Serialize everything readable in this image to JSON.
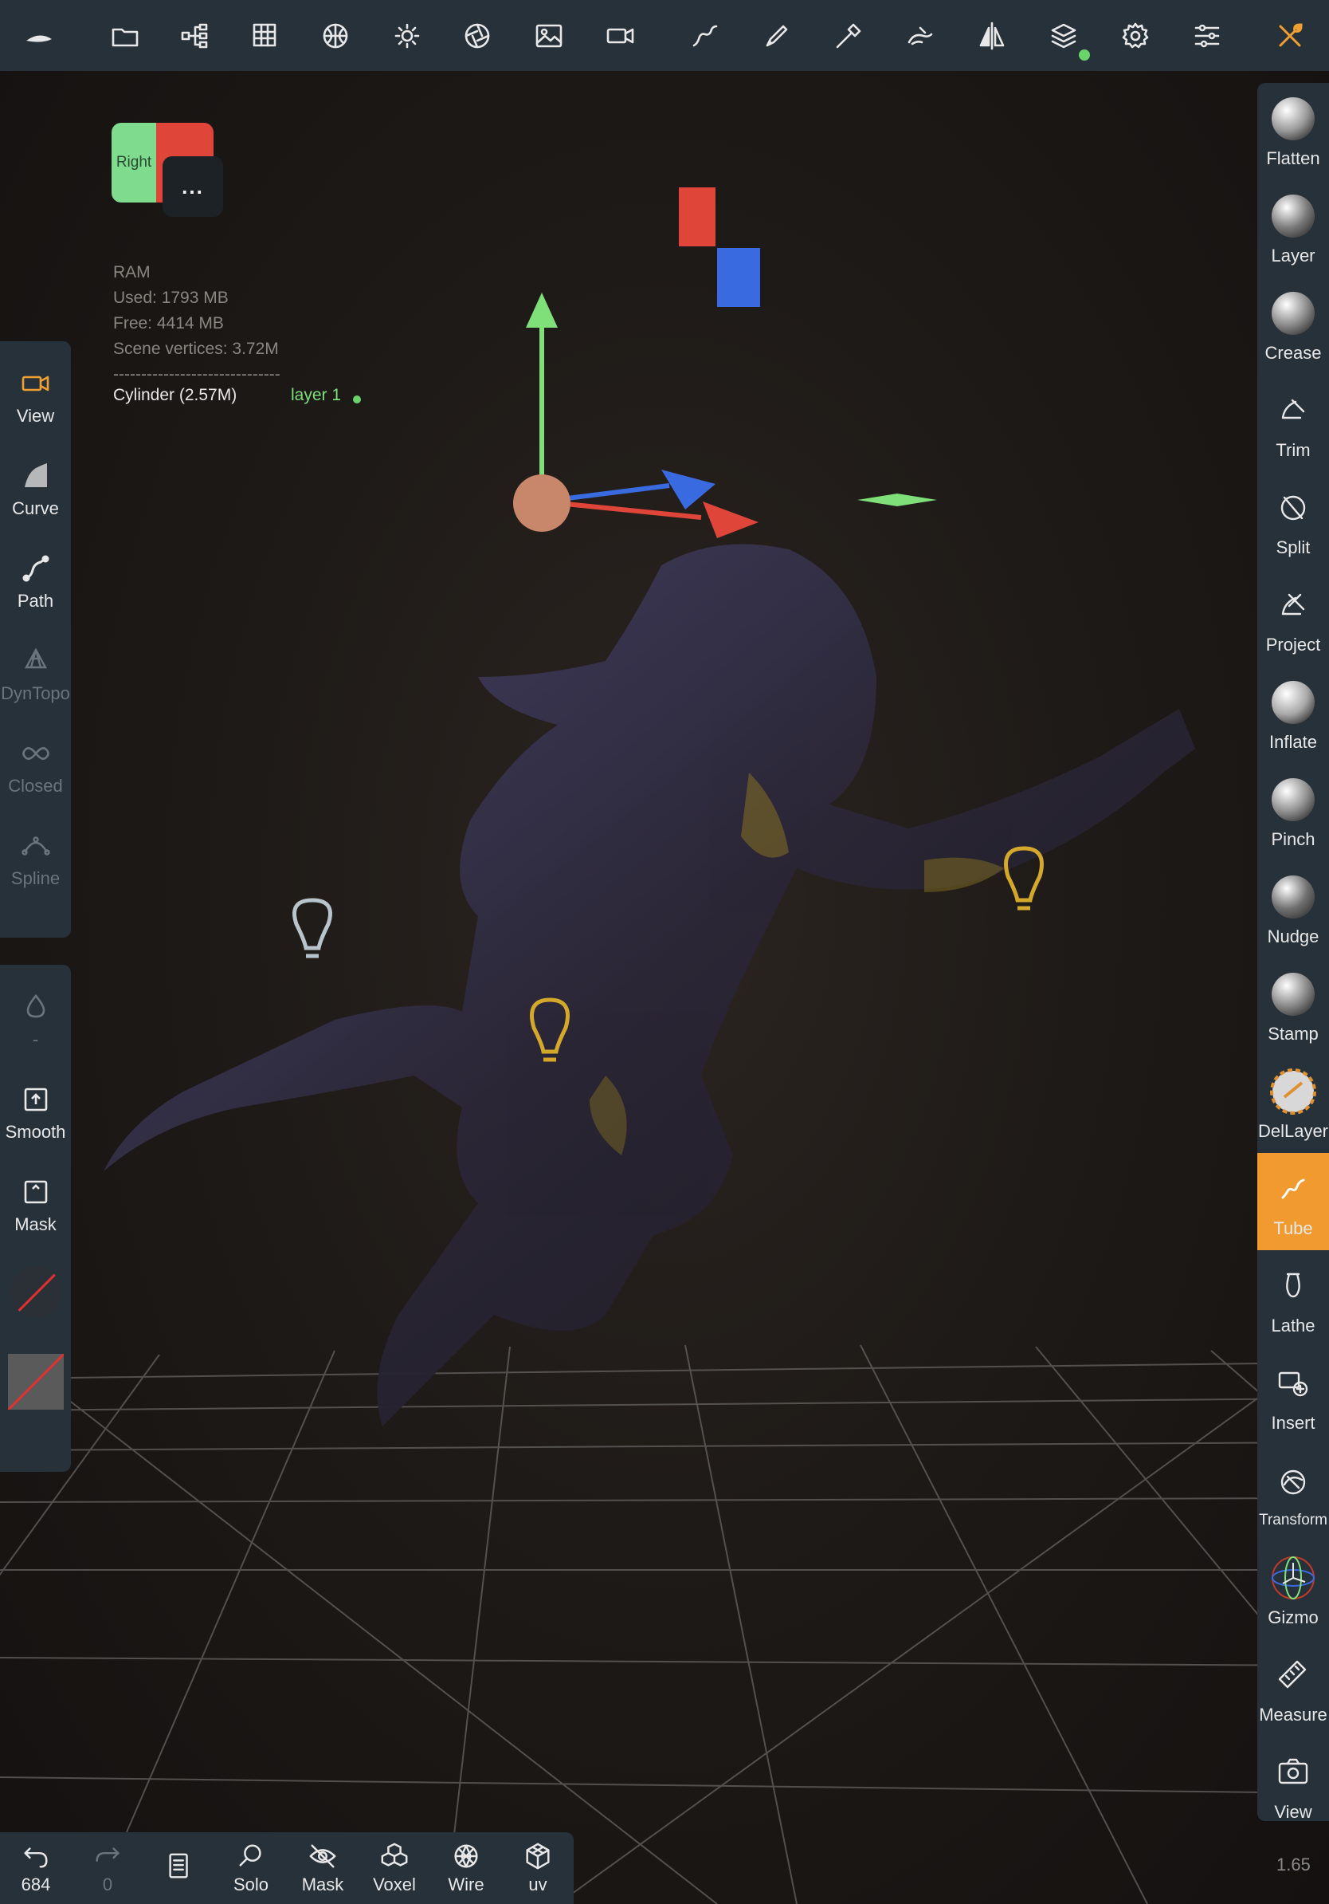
{
  "toolbar": {
    "icons": [
      "logo-icon",
      "folder-icon",
      "scene-tree-icon",
      "grid-menu-icon",
      "topology-icon",
      "light-icon",
      "shading-icon",
      "image-icon",
      "camera-icon",
      "curve-stroke-icon",
      "brush-icon",
      "paint-icon",
      "sculpt-icon",
      "symmetry-icon",
      "layers-icon",
      "settings-icon",
      "sliders-icon",
      "tools-icon"
    ]
  },
  "view_cube": {
    "face_label": "Right",
    "more_label": "..."
  },
  "info": {
    "ram_label": "RAM",
    "used": "Used: 1793 MB",
    "free": "Free: 4414 MB",
    "vertices": "Scene vertices: 3.72M",
    "separator": "------------------------------",
    "object": "Cylinder (2.57M)",
    "layer": "layer 1"
  },
  "left_top": [
    {
      "label": "View",
      "icon": "camera-icon",
      "active": true
    },
    {
      "label": "Curve",
      "icon": "curve-icon"
    },
    {
      "label": "Path",
      "icon": "path-icon"
    },
    {
      "label": "DynTopo",
      "icon": "dyntopo-icon",
      "disabled": true
    },
    {
      "label": "Closed",
      "icon": "infinity-icon",
      "disabled": true
    },
    {
      "label": "Spline",
      "icon": "spline-icon",
      "disabled": true
    }
  ],
  "left_bottom": [
    {
      "label": "-",
      "icon": "drop-icon",
      "disabled": true
    },
    {
      "label": "Smooth",
      "icon": "smooth-icon"
    },
    {
      "label": "Mask",
      "icon": "mask-icon"
    }
  ],
  "right_tools": [
    {
      "label": "Flatten",
      "icon": "flatten-icon"
    },
    {
      "label": "Layer",
      "icon": "layer-icon"
    },
    {
      "label": "Crease",
      "icon": "crease-icon"
    },
    {
      "label": "Trim",
      "icon": "trim-icon"
    },
    {
      "label": "Split",
      "icon": "split-icon"
    },
    {
      "label": "Project",
      "icon": "project-icon"
    },
    {
      "label": "Inflate",
      "icon": "inflate-icon"
    },
    {
      "label": "Pinch",
      "icon": "pinch-icon"
    },
    {
      "label": "Nudge",
      "icon": "nudge-icon"
    },
    {
      "label": "Stamp",
      "icon": "stamp-icon"
    },
    {
      "label": "DelLayer",
      "icon": "dellayer-icon"
    },
    {
      "label": "Tube",
      "icon": "tube-icon",
      "active": true
    },
    {
      "label": "Lathe",
      "icon": "lathe-icon"
    },
    {
      "label": "Insert",
      "icon": "insert-icon"
    },
    {
      "label": "Transform",
      "icon": "transform-icon"
    },
    {
      "label": "Gizmo",
      "icon": "gizmo-icon"
    },
    {
      "label": "Measure",
      "icon": "ruler-icon"
    },
    {
      "label": "View",
      "icon": "screenshot-icon"
    }
  ],
  "bottom_bar": [
    {
      "label": "684",
      "icon": "undo-icon"
    },
    {
      "label": "0",
      "icon": "redo-icon",
      "disabled": true
    },
    {
      "label": "",
      "icon": "history-icon"
    },
    {
      "label": "Solo",
      "icon": "search-icon"
    },
    {
      "label": "Mask",
      "icon": "eye-off-icon"
    },
    {
      "label": "Voxel",
      "icon": "voxel-icon"
    },
    {
      "label": "Wire",
      "icon": "wire-icon"
    },
    {
      "label": "uv",
      "icon": "uv-icon"
    }
  ],
  "zoom_level": "1.65",
  "colors": {
    "panel": "#27313a",
    "accent": "#f19a30",
    "axis_x": "#e0453a",
    "axis_y": "#7fe07a",
    "axis_z": "#3a6ae0",
    "light_warm": "#d4a82a",
    "light_cool": "#b8c4cc"
  }
}
